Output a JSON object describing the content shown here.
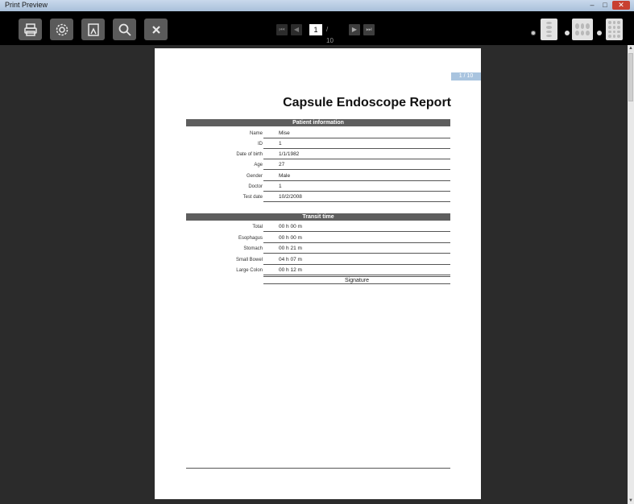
{
  "window": {
    "title": "Print Preview",
    "controls": {
      "minimize": "–",
      "maximize": "□",
      "close": "✕"
    }
  },
  "toolbar": {
    "buttons": [
      {
        "name": "print",
        "icon": "printer-icon"
      },
      {
        "name": "settings",
        "icon": "gear-icon"
      },
      {
        "name": "export",
        "icon": "document-icon"
      },
      {
        "name": "zoom",
        "icon": "magnifier-icon"
      },
      {
        "name": "close",
        "icon": "close-icon"
      }
    ],
    "pager": {
      "current": "1",
      "total": "/ 10",
      "first": "⏮",
      "prev": "◀",
      "next": "▶",
      "last": "⏭"
    },
    "layouts": [
      "single-page",
      "multi-page",
      "grid-page"
    ]
  },
  "report": {
    "page_tag": "1 / 10",
    "title": "Capsule Endoscope Report",
    "patient_section": "Patient information",
    "patient_rows": [
      {
        "label": "Name",
        "value": "Mise"
      },
      {
        "label": "ID",
        "value": "1"
      },
      {
        "label": "Date of birth",
        "value": "1/1/1982"
      },
      {
        "label": "Age",
        "value": "27"
      },
      {
        "label": "Gender",
        "value": "Male"
      },
      {
        "label": "Doctor",
        "value": "1"
      },
      {
        "label": "Test date",
        "value": "10/2/2008"
      }
    ],
    "transit_section": "Transit time",
    "transit_rows": [
      {
        "label": "Total",
        "value": "00 h 00 m"
      },
      {
        "label": "Esophagus",
        "value": "00 h 00 m"
      },
      {
        "label": "Stomach",
        "value": "00 h 21 m"
      },
      {
        "label": "Small Bowel",
        "value": "04 h 07 m"
      },
      {
        "label": "Large Colon",
        "value": "00 h 12 m"
      }
    ],
    "signature": "Signature"
  },
  "colors": {
    "toolbar": "#000000",
    "workspace": "#2b2b2b",
    "section_header": "#5e5e5e",
    "page_tag": "#a9c4df"
  }
}
